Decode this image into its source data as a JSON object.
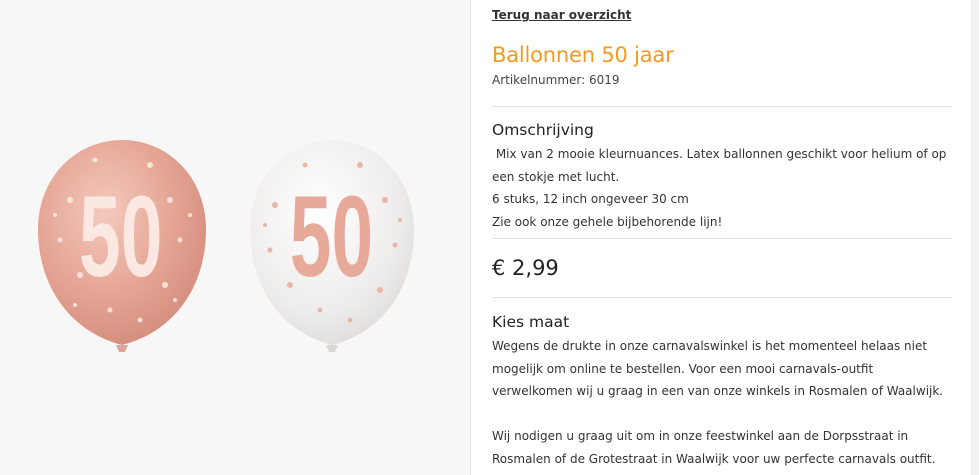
{
  "back_link": "Terug naar overzicht",
  "product": {
    "title": "Ballonnen 50 jaar",
    "article_number": "Artikelnummer: 6019"
  },
  "description": {
    "heading": "Omschrijving",
    "lines": [
      " Mix van 2 mooie kleurnuances. Latex ballonnen geschikt voor helium of op",
      "een stokje met lucht.",
      "6 stuks, 12 inch ongeveer 30 cm",
      "Zie ook onze gehele bijbehorende lijn!"
    ]
  },
  "price": "€ 2,99",
  "size": {
    "heading": "Kies maat",
    "paragraph1": "Wegens de drukte in onze carnavalswinkel is het momenteel helaas niet mogelijk om online te bestellen. Voor een mooi carnavals-outfit verwelkomen wij u graag in een van onze winkels in Rosmalen of Waalwijk.",
    "paragraph2": "Wij nodigen u graag uit om in onze feestwinkel aan de Dorpsstraat in Rosmalen of de Grotestraat in Waalwijk voor uw perfecte carnavals outfit."
  },
  "balloons": {
    "number_text": "50",
    "rose_gold": "#e6a898",
    "white": "#f3f1f1",
    "confetti": "#f7e2dc"
  }
}
